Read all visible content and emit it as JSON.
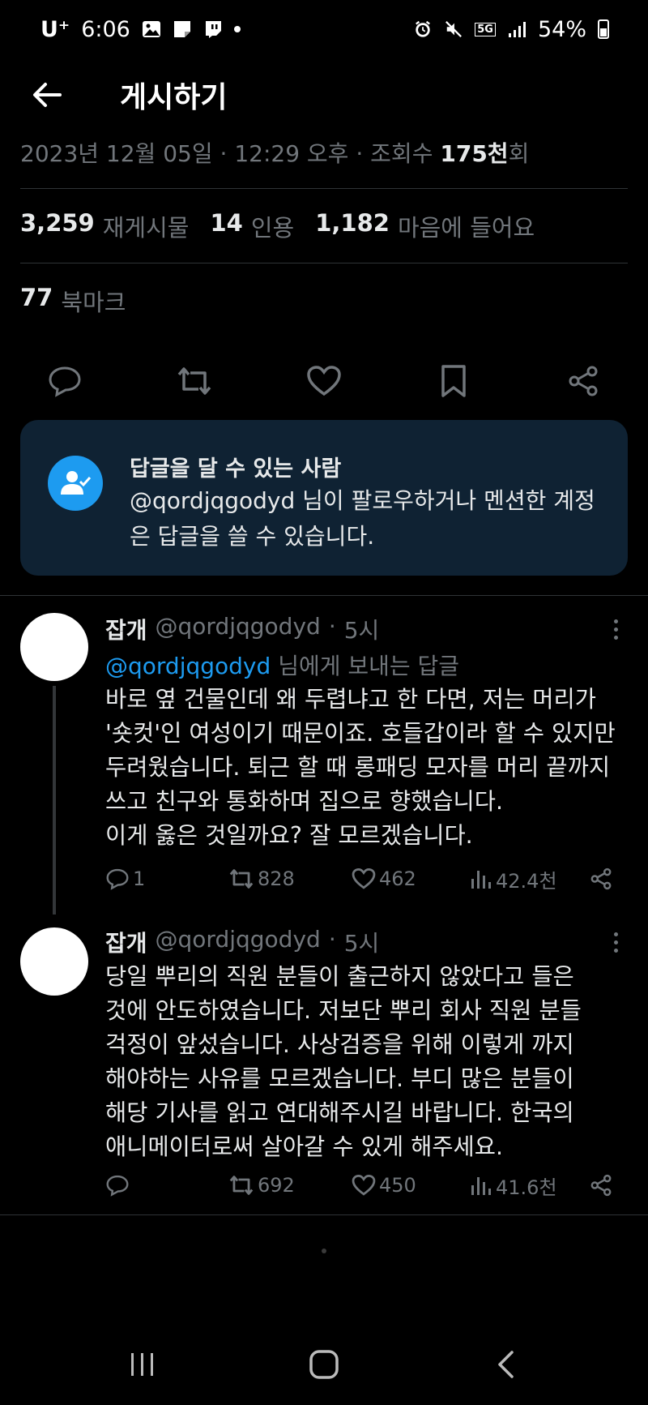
{
  "status_bar": {
    "carrier": "U⁺",
    "time": "6:06",
    "network": "5G",
    "battery": "54%",
    "left_icons": [
      "gallery-icon",
      "note-icon",
      "twitch-icon",
      "dot-icon"
    ],
    "right_icons": [
      "alarm-icon",
      "mute-icon",
      "5g-icon",
      "signal-icon",
      "battery-icon"
    ]
  },
  "header": {
    "title": "게시하기"
  },
  "post_meta": {
    "date": "2023년 12월 05일",
    "time": "12:29 오후",
    "views_label": "조회수",
    "views_value": "175천",
    "views_suffix": "회",
    "separator": "·"
  },
  "stats": {
    "reposts": {
      "num": "3,259",
      "label": "재게시물"
    },
    "quotes": {
      "num": "14",
      "label": "인용"
    },
    "likes": {
      "num": "1,182",
      "label": "마음에 들어요"
    },
    "bookmarks": {
      "num": "77",
      "label": "북마크"
    }
  },
  "actions": [
    "reply-icon",
    "repost-icon",
    "heart-icon",
    "bookmark-icon",
    "share-icon"
  ],
  "reply_restriction": {
    "title": "답글을 달 수 있는 사람",
    "body": "@qordjqgodyd 님이 팔로우하거나 멘션한 계정은 답글을 쓸 수 있습니다."
  },
  "replies": [
    {
      "name": "잡개",
      "handle": "@qordjqgodyd",
      "time": "5시",
      "dot": "·",
      "reply_to_mention": "@qordjqgodyd",
      "reply_to_suffix": "님에게 보내는 답글",
      "lines": [
        "바로 옆 건물인데 왜 두렵냐고 한 다면, 저는 머리가",
        "'숏컷'인 여성이기 때문이죠. 호들갑이라 할 수 있지만",
        "두려웠습니다. 퇴근 할 때 롱패딩 모자를 머리 끝까지",
        "쓰고 친구와 통화하며 집으로 향했습니다.",
        "이게 옳은 것일까요? 잘 모르겠습니다."
      ],
      "reply_count": "1",
      "reposts": "828",
      "likes": "462",
      "views": "42.4천"
    },
    {
      "name": "잡개",
      "handle": "@qordjqgodyd",
      "time": "5시",
      "dot": "·",
      "lines": [
        "당일 뿌리의 직원 분들이 출근하지 않았다고 들은",
        "것에 안도하였습니다. 저보단 뿌리 회사 직원 분들",
        "걱정이 앞섰습니다. 사상검증을 위해 이렇게 까지",
        "해야하는 사유를 모르겠습니다. 부디 많은 분들이",
        "해당 기사를 읽고 연대해주시길 바랍니다. 한국의",
        "애니메이터로써 살아갈 수 있게 해주세요."
      ],
      "reply_count": "",
      "reposts": "692",
      "likes": "450",
      "views": "41.6천"
    }
  ],
  "nav_bar": [
    "recents-icon",
    "home-icon",
    "back-icon"
  ],
  "colors": {
    "background": "#000000",
    "text": "#e7e9ea",
    "muted": "#71767b",
    "accent": "#1d9bf0",
    "card": "#0f2233"
  }
}
